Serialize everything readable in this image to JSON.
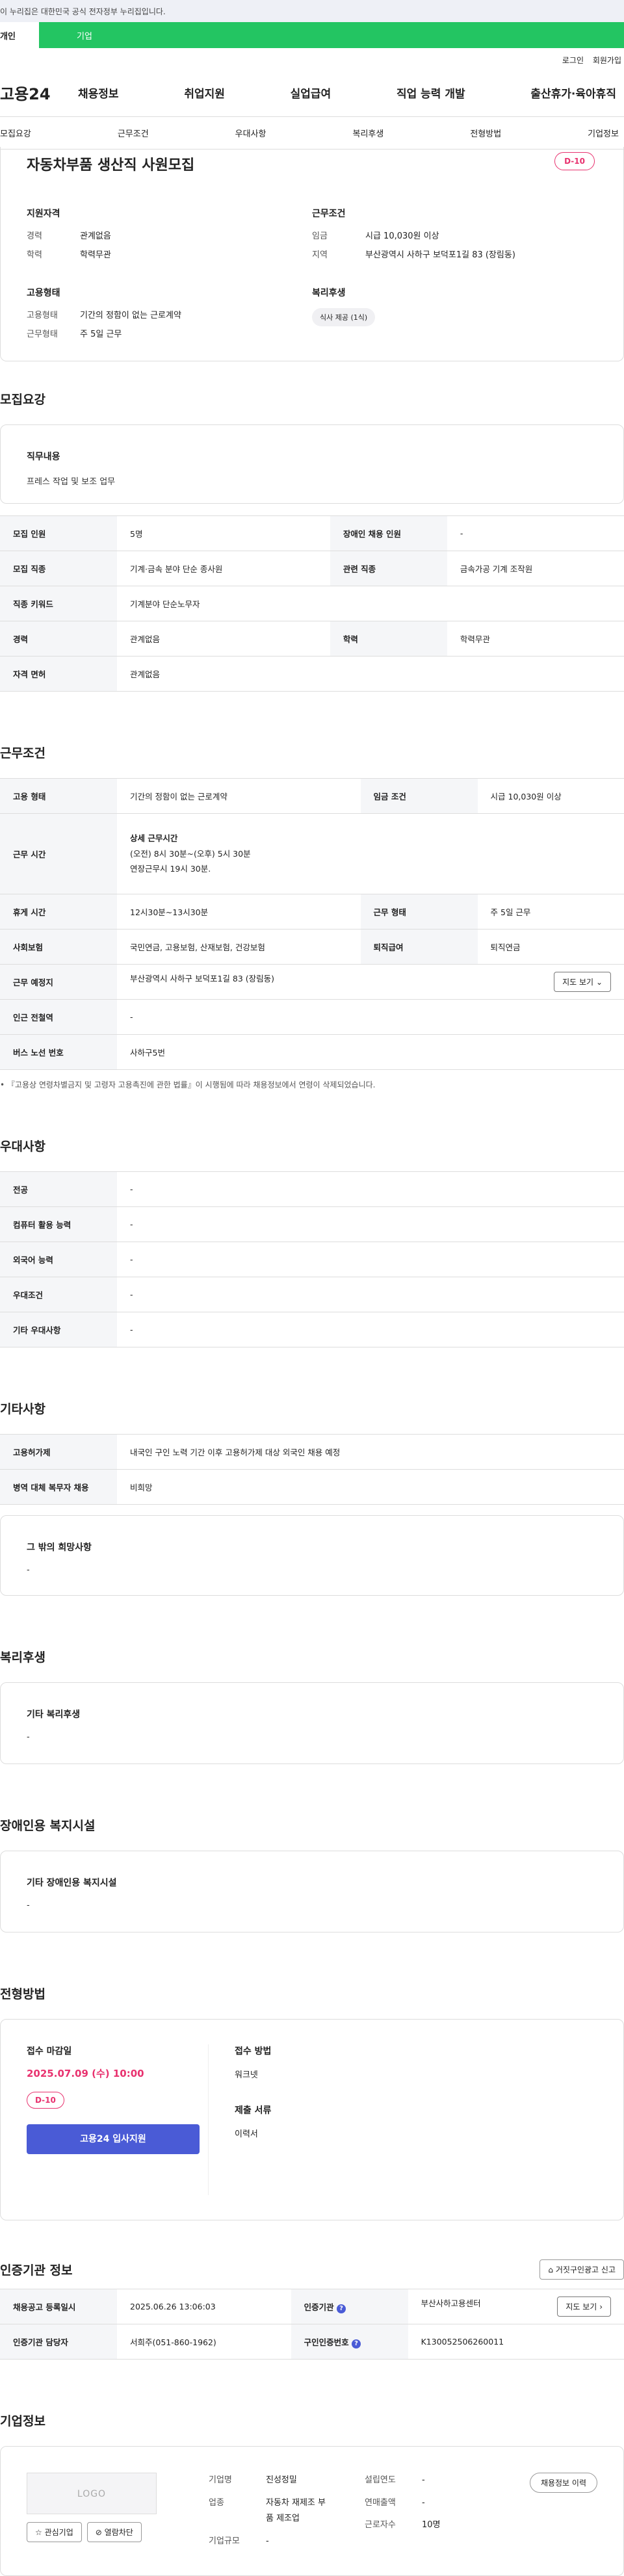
{
  "banner": {
    "text": "이 누리집은 대한민국 공식 전자정부 누리집입니다."
  },
  "top_tabs": {
    "personal": "개인",
    "company": "기업"
  },
  "util": {
    "login": "로그인",
    "join": "회원가입"
  },
  "gnb": {
    "logo": "고용24",
    "menu": [
      "채용정보",
      "취업지원",
      "실업급여",
      "직업 능력 개발",
      "출산휴가·육아휴직"
    ]
  },
  "subnav": [
    "모집요강",
    "근무조건",
    "우대사항",
    "복리후생",
    "전형방법",
    "기업정보"
  ],
  "summary": {
    "title": "자동차부품 생산직 사원모집",
    "dday": "D-10",
    "qual": {
      "title": "지원자격",
      "rows": [
        {
          "k": "경력",
          "v": "관계없음"
        },
        {
          "k": "학력",
          "v": "학력무관"
        }
      ]
    },
    "work": {
      "title": "근무조건",
      "rows": [
        {
          "k": "임금",
          "v": "시급 10,030원 이상"
        },
        {
          "k": "지역",
          "v": "부산광역시 사하구 보덕포1길 83 (장림동)"
        }
      ]
    },
    "emp": {
      "title": "고용형태",
      "rows": [
        {
          "k": "고용형태",
          "v": "기간의 정함이 없는 근로계약"
        },
        {
          "k": "근무형태",
          "v": "주 5일 근무"
        }
      ]
    },
    "welfare": {
      "title": "복리후생",
      "chip": "식사 제공 (1식)"
    }
  },
  "recruit": {
    "title": "모집요강",
    "job_title": "직무내용",
    "job_value": "프레스 작업 및 보조 업무",
    "rows": [
      {
        "h1": "모집 인원",
        "v1": "5명",
        "h2": "장애인 채용 인원",
        "v2": "-"
      },
      {
        "h1": "모집 직종",
        "v1": "기계·금속 분야 단순 종사원",
        "h2": "관련 직종",
        "v2": "금속가공 기계 조작원"
      },
      {
        "h1": "직종 키워드",
        "v1": "기계분야 단순노무자"
      },
      {
        "h1": "경력",
        "v1": "관계없음",
        "h2": "학력",
        "v2": "학력무관"
      },
      {
        "h1": "자격 면허",
        "v1": "관계없음"
      }
    ]
  },
  "conditions": {
    "title": "근무조건",
    "emp_type_h": "고용 형태",
    "emp_type_v": "기간의 정함이 없는 근로계약",
    "wage_h": "임금 조건",
    "wage_v": "시급 10,030원 이상",
    "hours_h": "근무 시간",
    "hours_title": "상세 근무시간",
    "hours_line1": "(오전) 8시 30분~(오후) 5시 30분",
    "hours_line2": "연장근무시 19시 30분.",
    "break_h": "휴게 시간",
    "break_v": "12시30분~13시30분",
    "form_h": "근무 형태",
    "form_v": "주 5일 근무",
    "ins_h": "사회보험",
    "ins_v": "국민연금, 고용보험, 산재보험, 건강보험",
    "sev_h": "퇴직급여",
    "sev_v": "퇴직연금",
    "place_h": "근무 예정지",
    "place_v": "부산광역시 사하구 보덕포1길 83 (장림동)",
    "map_btn": "지도 보기",
    "station_h": "인근 전철역",
    "station_v": "-",
    "bus_h": "버스 노선 번호",
    "bus_v": "사하구5번",
    "note": "『고용상 연령차별금지 및 고령자 고용촉진에 관한 법률』이 시행됨에 따라 채용정보에서 연령이 삭제되었습니다."
  },
  "pref": {
    "title": "우대사항",
    "rows": [
      {
        "h": "전공",
        "v": "-"
      },
      {
        "h": "컴퓨터 활용 능력",
        "v": "-"
      },
      {
        "h": "외국어 능력",
        "v": "-"
      },
      {
        "h": "우대조건",
        "v": "-"
      },
      {
        "h": "기타 우대사항",
        "v": "-"
      }
    ]
  },
  "etc": {
    "title": "기타사항",
    "rows": [
      {
        "h": "고용허가제",
        "v": "내국인 구인 노력 기간 이후 고용허가제 대상 외국인 채용 예정"
      },
      {
        "h": "병역 대체 복무자 채용",
        "v": "비희망"
      }
    ],
    "box_title": "그 밖의 희망사항",
    "box_value": "-"
  },
  "welfare": {
    "title": "복리후생",
    "box_title": "기타 복리후생",
    "box_value": "-"
  },
  "disab": {
    "title": "장애인용 복지시설",
    "box_title": "기타 장애인용 복지시설",
    "box_value": "-"
  },
  "apply": {
    "title": "전형방법",
    "deadline_label": "접수 마감일",
    "deadline": "2025.07.09 (수) 10:00",
    "dday": "D-10",
    "btn": "고용24 입사지원",
    "method_label": "접수 방법",
    "method_value": "워크넷",
    "docs_label": "제출 서류",
    "docs_value": "이력서"
  },
  "cert": {
    "title": "인증기관 정보",
    "report_btn": "거짓구인광고 신고",
    "reg_h": "채용공고 등록일시",
    "reg_v": "2025.06.26 13:06:03",
    "org_h": "인증기관",
    "org_v": "부산사하고용센터",
    "map_btn": "지도 보기",
    "mgr_h": "인증기관 담당자",
    "mgr_v": "서희주(051-860-1962)",
    "num_h": "구인인증번호",
    "num_v": "K130052506260011"
  },
  "corp": {
    "title": "기업정보",
    "logo": "LOGO",
    "fav_btn": "관심기업",
    "block_btn": "열람차단",
    "name_h": "기업명",
    "name_v": "진성정밀",
    "ind_h": "업종",
    "ind_v1": "자동차 재제조 부",
    "ind_v2": "품 제조업",
    "size_h": "기업규모",
    "size_v": "-",
    "est_h": "설립연도",
    "est_v": "-",
    "sales_h": "연매출액",
    "sales_v": "-",
    "emp_h": "근로자수",
    "emp_v": "10명",
    "history_btn": "채용정보 이력"
  }
}
